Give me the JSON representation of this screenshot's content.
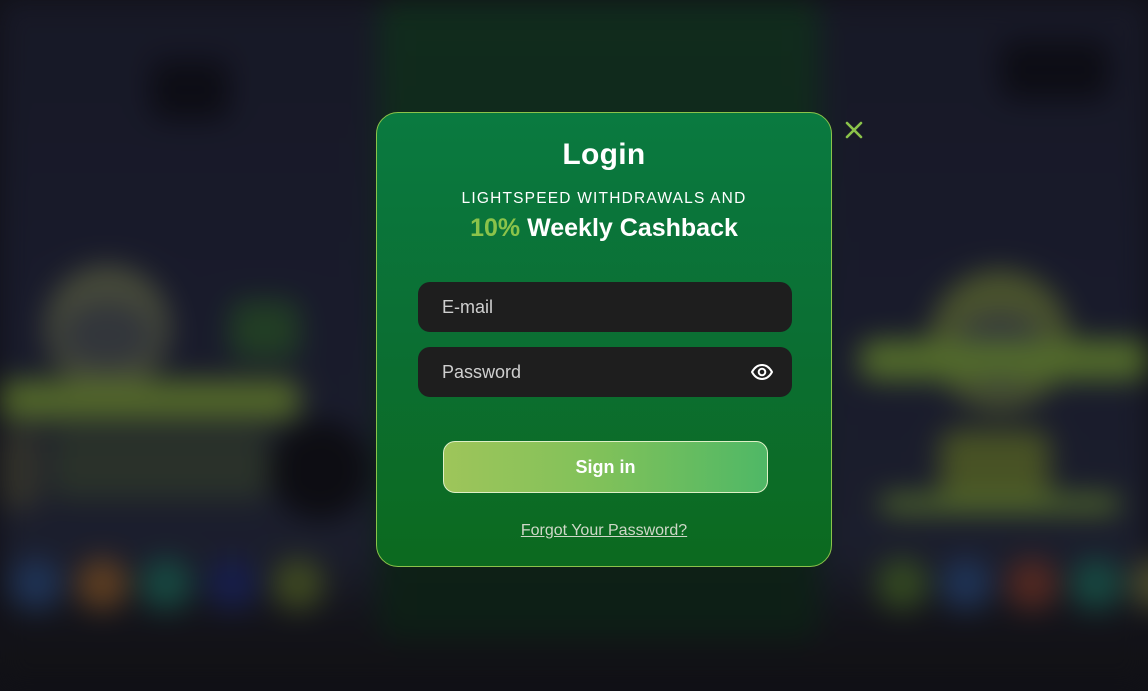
{
  "modal": {
    "title": "Login",
    "subtitle": "LIGHTSPEED WITHDRAWALS AND",
    "cashback_percent": "10%",
    "cashback_label": "Weekly Cashback",
    "email_placeholder": "E-mail",
    "password_placeholder": "Password",
    "signin_label": "Sign in",
    "forgot_label": "Forgot Your Password?"
  },
  "icons": {
    "close": "close-icon",
    "eye": "eye-icon"
  },
  "colors": {
    "accent": "#8bc34a",
    "modal_bg": "#0b6f33",
    "input_bg": "#1e1e1e"
  }
}
